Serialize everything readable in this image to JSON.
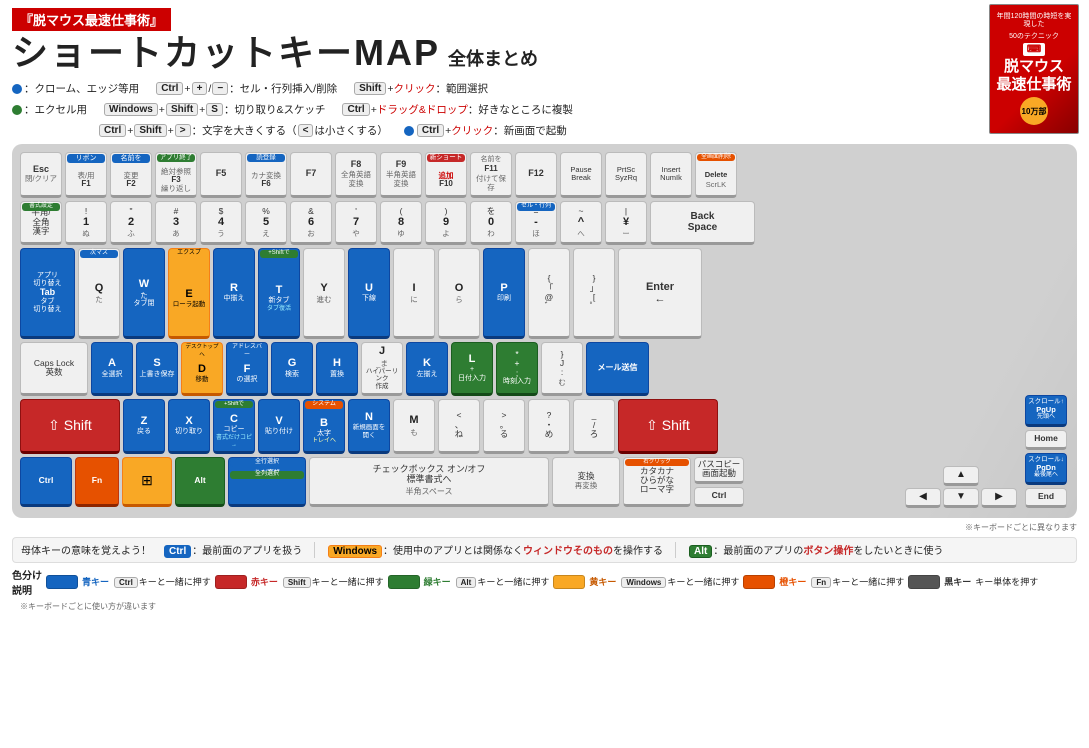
{
  "header": {
    "title_box": "『脱マウス最速仕事術』",
    "main_title": "ショートカットキーMAP",
    "sub_title": "全体まとめ"
  },
  "book": {
    "top_text": "年間120時間の時短を実現した",
    "series": "50のテクニック",
    "title1": "脱マウス",
    "title2": "最速仕事術",
    "badge": "10万部"
  },
  "legend": {
    "chrome_label": "：クローム、エッジ等用",
    "excel_label": "：エクセル用",
    "items": [
      "Ctrl + + / − : セル・行列挿入/削除",
      "Windows + Shift + S : 切り取り&スケッチ",
      "Ctrl + Shift + > : 文字を大きくする（<は小さくする）",
      "Shift + クリック：範囲選択",
      "Ctrl + ドラッグ&ドロップ：好きなところに複製",
      "Ctrl + クリック：新画面で起動"
    ]
  },
  "keyboard": {
    "rows": []
  },
  "bottom": {
    "ctrl_label": "Ctrl",
    "ctrl_desc": "：最前面のアプリを扱う",
    "windows_label": "Windows",
    "windows_desc": "：使用中のアプリとは関係なくウィンドウそのものを操作する",
    "alt_label": "Alt",
    "alt_desc": "：最前面のアプリのボタン操作をしたいときに使う"
  },
  "color_legend": {
    "label": "色分け説明",
    "items": [
      {
        "color": "blue",
        "key": "青キー",
        "desc": "Ctrl キーと一緒に押す"
      },
      {
        "color": "red",
        "key": "赤キー",
        "desc": "Shift キーと一緒に押す"
      },
      {
        "color": "green",
        "key": "緑キー",
        "desc": "Alt キーと一緒に押す"
      },
      {
        "color": "yellow",
        "key": "黄キー",
        "desc": "Windows キーと一緒に押す"
      },
      {
        "color": "orange",
        "key": "橙キー",
        "desc": "Fn キーと一緒に押す"
      },
      {
        "color": "dark",
        "key": "黒キー",
        "desc": "キー単体を押す"
      }
    ],
    "note": "※キーボードごとに使い方が違います"
  },
  "note": "※キーボードごとに異なります"
}
